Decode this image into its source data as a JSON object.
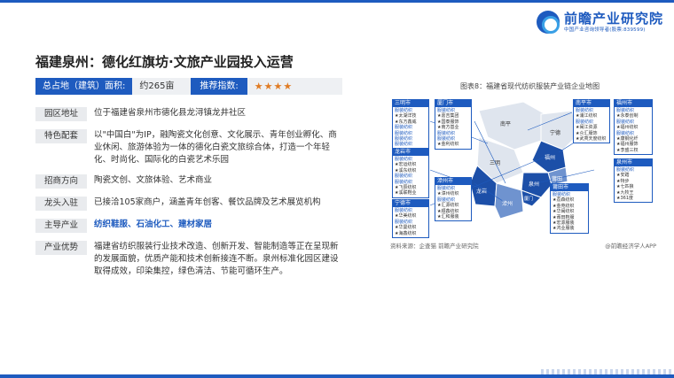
{
  "brand": {
    "name": "前瞻产业研究院",
    "tagline": "中国产业咨询领导者(股票:839599)"
  },
  "page": {
    "title": "福建泉州：德化红旗坊·文旅产业园投入运营"
  },
  "summary": {
    "area_label": "总占地（建筑）面积:",
    "area_value": "约265亩",
    "rec_label": "推荐指数:",
    "stars": "★★★★"
  },
  "rows": [
    {
      "label": "园区地址",
      "value": "位于福建省泉州市德化县龙浔镇龙井社区"
    },
    {
      "label": "特色配套",
      "value": "以\"中国白\"为IP，融陶瓷文化创意、文化展示、青年创业孵化、商业休闲、旅游体验为一体的德化白瓷文旅综合体，打造一个年轻化、时尚化、国际化的白瓷艺术乐园"
    },
    {
      "label": "招商方向",
      "value": "陶瓷文创、文旅体验、艺术商业"
    },
    {
      "label": "龙头入驻",
      "value": "已接洽105家商户，涵盖青年创客、餐饮品牌及艺术展览机构"
    },
    {
      "label": "主导产业",
      "value": "纺织鞋服、石油化工、建材家居"
    },
    {
      "label": "产业优势",
      "value": "福建省纺织服装行业技术改造、创新开发、智能制造等正在呈现新的发展面貌，优质产能和技术创新接连不断。泉州标准化园区建设取得成效，印染集控，绿色清洁、节能可循环生产。"
    }
  ],
  "figure": {
    "caption": "图表8：福建省现代纺织服装产业链企业地图",
    "source": "资料来源：企查猫 前瞻产业研究院",
    "source_right": "@前瞻经济学人APP",
    "map_labels": [
      "南平",
      "三明",
      "宁德",
      "福州",
      "莆田",
      "泉州",
      "漳州",
      "龙岩",
      "厦门"
    ],
    "cities": [
      {
        "name": "三明市",
        "lines": [
          "服装纺织",
          "★太湖洋技",
          "★东方鑫威",
          "服装纺织",
          "服装纺织",
          "服装纺织",
          "服装纺织"
        ]
      },
      {
        "name": "厦门市",
        "lines": [
          "服装纺织",
          "★嘉吉集团",
          "★国泰服饰",
          "★南方基业",
          "服装纺织",
          "服装纺织",
          "★金利纺织"
        ]
      },
      {
        "name": "南平市",
        "lines": [
          "服装纺织",
          "★浦江纺织",
          "服装纺织",
          "★闽江资源",
          "★众汇服饰",
          "★武夷天度纺织"
        ]
      },
      {
        "name": "福州市",
        "lines": [
          "服装纺织",
          "★永泰创制",
          "服装纺织",
          "★福州纺织",
          "服装纺织",
          "★康钢化纤",
          "★福州服饰",
          "★李盛三权"
        ]
      },
      {
        "name": "龙岩市",
        "lines": [
          "服装纺织",
          "★宏运纺织",
          "★溪东纺织",
          "服装纺织",
          "服装纺织",
          "★飞辰纺织",
          "★溪联鞋业"
        ]
      },
      {
        "name": "漳州市",
        "lines": [
          "服装纺织",
          "★漳州纺织",
          "服装纺织",
          "★汇源纺织",
          "★顺鑫纺织",
          "★汇和服装"
        ]
      },
      {
        "name": "泉州市",
        "lines": [
          "服装纺织",
          "★安踏",
          "★特步",
          "★七匹狼",
          "★九牧王",
          "★361度"
        ]
      },
      {
        "name": "宁德市",
        "lines": [
          "服装纺织",
          "★华美纺织",
          "服装纺织",
          "★华曼纺织",
          "★海鑫纺织",
          "★闽宁鞋业"
        ]
      },
      {
        "name": "莆田市",
        "lines": [
          "服装纺织",
          "★荔森纺织",
          "★金苑纺织",
          "★华闽纺织",
          "★莆田鞋服",
          "★宏源服装",
          "★鸿业服装"
        ]
      }
    ]
  },
  "colors": {
    "primary": "#1e5bbf",
    "map_dark": "#1c4fa8",
    "map_mid": "#6f93cf",
    "map_light": "#dfe5ee",
    "star": "#e07b23"
  }
}
